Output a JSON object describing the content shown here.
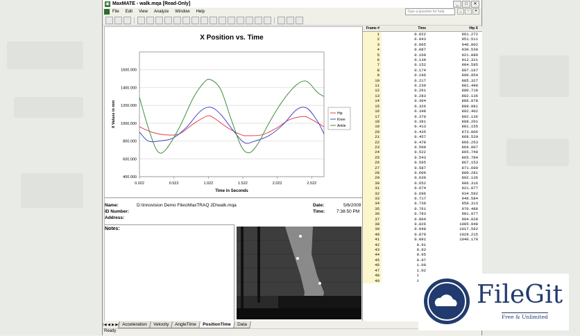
{
  "window": {
    "title": "MaxMATE - walk.mqa  [Read-Only]",
    "help_placeholder": "Type a question for help"
  },
  "menu": [
    "File",
    "Edit",
    "View",
    "Analyze",
    "Window",
    "Help"
  ],
  "chart_data": {
    "type": "line",
    "title": "X Position vs. Time",
    "xlabel": "Time in Seconds",
    "ylabel": "X Values in mm",
    "xlim": [
      0.022,
      2.7
    ],
    "ylim": [
      400,
      1800
    ],
    "x_ticks": [
      "0.022",
      "0.522",
      "1.022",
      "1.522",
      "2.022",
      "2.522"
    ],
    "y_ticks": [
      "400.000",
      "600.000",
      "800.000",
      "1000.000",
      "1200.000",
      "1400.000",
      "1600.000"
    ],
    "legend_position": "right",
    "series": [
      {
        "name": "Hip",
        "color": "#e0404a",
        "x": [
          0.022,
          0.2,
          0.4,
          0.6,
          0.8,
          1.0,
          1.1,
          1.3,
          1.5,
          1.6,
          1.8,
          2.0,
          2.2,
          2.4,
          2.5,
          2.7
        ],
        "y": [
          960,
          900,
          870,
          880,
          990,
          1080,
          1060,
          950,
          870,
          860,
          870,
          940,
          1040,
          1075,
          1050,
          960
        ]
      },
      {
        "name": "Knee",
        "color": "#4545c8",
        "x": [
          0.022,
          0.15,
          0.3,
          0.5,
          0.7,
          0.9,
          1.05,
          1.2,
          1.4,
          1.55,
          1.7,
          1.9,
          2.1,
          2.3,
          2.45,
          2.6,
          2.7
        ],
        "y": [
          900,
          800,
          800,
          830,
          950,
          1130,
          1180,
          1100,
          900,
          780,
          800,
          860,
          980,
          1150,
          1170,
          1030,
          880
        ]
      },
      {
        "name": "Ankle",
        "color": "#3a8f3a",
        "x": [
          0.022,
          0.15,
          0.28,
          0.4,
          0.6,
          0.8,
          0.95,
          1.05,
          1.2,
          1.35,
          1.5,
          1.62,
          1.75,
          1.9,
          2.1,
          2.3,
          2.45,
          2.6,
          2.7
        ],
        "y": [
          1290,
          950,
          690,
          700,
          950,
          1280,
          1450,
          1490,
          1380,
          1050,
          740,
          670,
          780,
          1000,
          1250,
          1430,
          1470,
          1350,
          1300
        ]
      }
    ]
  },
  "info": {
    "name_label": "Name:",
    "name_value": "D:\\Innovision Demo Files\\MaxTRAQ 2D\\walk.mqa",
    "id_label": "ID Number:",
    "address_label": "Address:",
    "date_label": "Date:",
    "date_value": "5/6/2009",
    "time_label": "Time:",
    "time_value": "7:38:50 PM",
    "notes_label": "Notes:"
  },
  "tabs": [
    "Acceleration",
    "Velocity",
    "AngleTime",
    "PositionTime",
    "Data"
  ],
  "active_tab": "PositionTime",
  "status": "Ready",
  "table": {
    "headers": [
      "Frame #",
      "Time",
      "Hip X"
    ],
    "rows": [
      [
        "1",
        "0.022",
        "961.272"
      ],
      [
        "2",
        "0.043",
        "951.511"
      ],
      [
        "3",
        "0.065",
        "940.802"
      ],
      [
        "4",
        "0.087",
        "930.530"
      ],
      [
        "5",
        "0.109",
        "921.089"
      ],
      [
        "6",
        "0.130",
        "912.321"
      ],
      [
        "7",
        "0.152",
        "904.595"
      ],
      [
        "8",
        "0.174",
        "897.167"
      ],
      [
        "9",
        "0.196",
        "890.954"
      ],
      [
        "10",
        "0.217",
        "885.327"
      ],
      [
        "11",
        "0.239",
        "881.498"
      ],
      [
        "12",
        "0.261",
        "880.718"
      ],
      [
        "13",
        "0.283",
        "882.136"
      ],
      [
        "14",
        "0.304",
        "886.078"
      ],
      [
        "15",
        "0.326",
        "889.981"
      ],
      [
        "16",
        "0.348",
        "892.402"
      ],
      [
        "17",
        "0.370",
        "892.136"
      ],
      [
        "18",
        "0.391",
        "888.201"
      ],
      [
        "19",
        "0.413",
        "881.155"
      ],
      [
        "20",
        "0.435",
        "873.806"
      ],
      [
        "21",
        "0.457",
        "868.520"
      ],
      [
        "22",
        "0.478",
        "866.253"
      ],
      [
        "23",
        "0.500",
        "866.007"
      ],
      [
        "24",
        "0.522",
        "865.740"
      ],
      [
        "25",
        "0.543",
        "865.784"
      ],
      [
        "26",
        "0.565",
        "867.153"
      ],
      [
        "27",
        "0.587",
        "871.690"
      ],
      [
        "28",
        "0.609",
        "880.281"
      ],
      [
        "29",
        "0.630",
        "892.136"
      ],
      [
        "30",
        "0.652",
        "906.316"
      ],
      [
        "31",
        "0.674",
        "921.077"
      ],
      [
        "32",
        "0.696",
        "934.592"
      ],
      [
        "33",
        "0.717",
        "946.584"
      ],
      [
        "34",
        "0.739",
        "958.313"
      ],
      [
        "35",
        "0.761",
        "970.488"
      ],
      [
        "36",
        "0.783",
        "981.977"
      ],
      [
        "37",
        "0.804",
        "994.028"
      ],
      [
        "38",
        "0.826",
        "1005.948"
      ],
      [
        "39",
        "0.848",
        "1017.562"
      ],
      [
        "40",
        "0.870",
        "1029.215"
      ],
      [
        "41",
        "0.891",
        "1040.170"
      ],
      [
        "42",
        "0.91",
        ""
      ],
      [
        "43",
        "0.93",
        ""
      ],
      [
        "44",
        "0.95",
        ""
      ],
      [
        "45",
        "0.97",
        ""
      ],
      [
        "46",
        "1.00",
        ""
      ],
      [
        "47",
        "1.02",
        ""
      ],
      [
        "48",
        "1.04",
        ""
      ],
      [
        "49",
        "1.06",
        ""
      ]
    ]
  },
  "watermark": {
    "title": "FileGit",
    "subtitle": "Free & Unlimited"
  }
}
